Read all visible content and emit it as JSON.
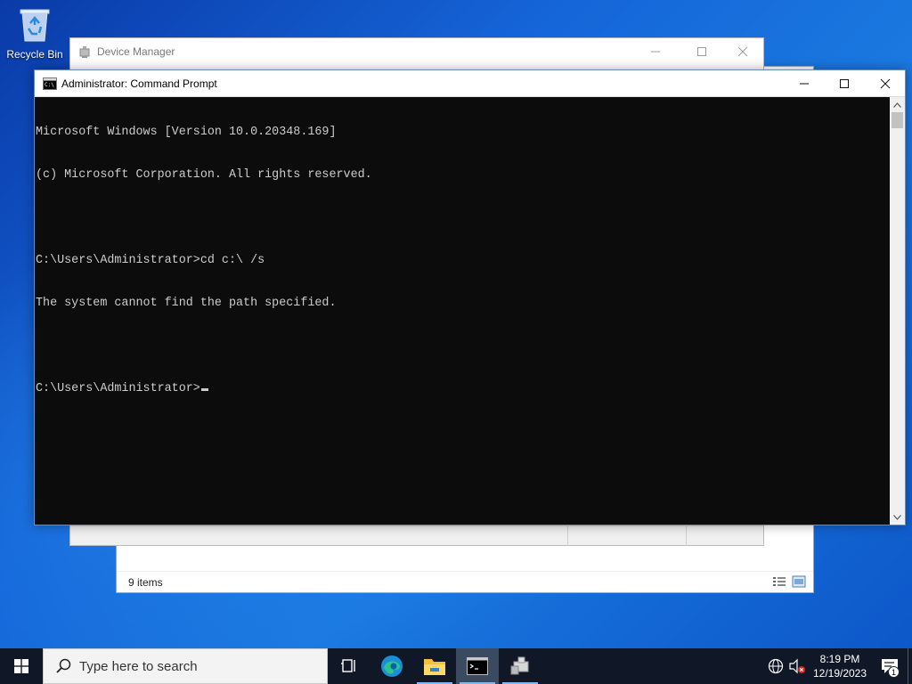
{
  "desktop": {
    "icons": [
      {
        "label": "Recycle Bin",
        "icon": "recycle-bin-icon"
      }
    ]
  },
  "explorer": {
    "status_count": "9 items"
  },
  "device_manager": {
    "title": "Device Manager"
  },
  "cmd": {
    "title": "Administrator: Command Prompt",
    "lines": [
      "Microsoft Windows [Version 10.0.20348.169]",
      "(c) Microsoft Corporation. All rights reserved.",
      "",
      "C:\\Users\\Administrator>cd c:\\ /s",
      "The system cannot find the path specified.",
      "",
      "C:\\Users\\Administrator>"
    ]
  },
  "taskbar": {
    "search_placeholder": "Type here to search",
    "apps": [
      {
        "name": "task-view-icon",
        "active": false
      },
      {
        "name": "edge-icon",
        "active": false
      },
      {
        "name": "file-explorer-icon",
        "active": false
      },
      {
        "name": "command-prompt-icon",
        "active": true
      },
      {
        "name": "device-manager-icon",
        "active": false
      }
    ],
    "clock_time": "8:19 PM",
    "clock_date": "12/19/2023",
    "notification_count": "1"
  },
  "colors": {
    "taskbar_bg": "#101828",
    "console_bg": "#0c0c0c",
    "console_fg": "#cccccc",
    "accent": "#0078d7"
  }
}
